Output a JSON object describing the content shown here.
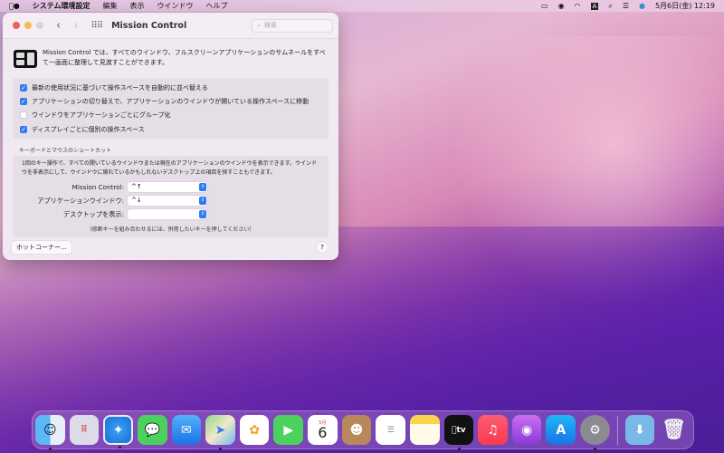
{
  "menubar": {
    "app": "システム環境設定",
    "items": [
      "編集",
      "表示",
      "ウインドウ",
      "ヘルプ"
    ],
    "clock": "5月6日(金)  12:19",
    "input_indicator": "A"
  },
  "window": {
    "title": "Mission Control",
    "search_placeholder": "検索",
    "intro": "Mission Control では、すべてのウインドウ、フルスクリーンアプリケーションのサムネールをすべて一画面に整理して見渡すことができます。",
    "options": [
      {
        "label": "最新の使用状況に基づいて操作スペースを自動的に並べ替える",
        "checked": true
      },
      {
        "label": "アプリケーションの切り替えで、アプリケーションのウインドウが開いている操作スペースに移動",
        "checked": true
      },
      {
        "label": "ウインドウをアプリケーションごとにグループ化",
        "checked": false
      },
      {
        "label": "ディスプレイごとに個別の操作スペース",
        "checked": true
      }
    ],
    "shortcuts_title": "キーボードとマウスのショートカット",
    "shortcuts_desc": "1回のキー操作で、すべての開いているウインドウまたは現在のアプリケーションのウインドウを表示できます。ウインドウを非表示にして、ウインドウに隠れているかもしれないデスクトップ上の項目を探すこともできます。",
    "shortcuts": [
      {
        "label": "Mission Control:",
        "value": "^↑"
      },
      {
        "label": "アプリケーションウインドウ:",
        "value": "^↓"
      },
      {
        "label": "デスクトップを表示:",
        "value": ""
      }
    ],
    "note": "（修飾キーを組み合わせるには、併用したいキーを押してください）",
    "hot_corners": "ホットコーナー...",
    "help": "?"
  },
  "dock": {
    "apps": [
      "Finder",
      "Launchpad",
      "Safari",
      "メッセージ",
      "メール",
      "マップ",
      "写真",
      "FaceTime",
      "カレンダー",
      "連絡先",
      "リマインダー",
      "メモ",
      "TV",
      "ミュージック",
      "Podcast",
      "App Store",
      "システム環境設定"
    ],
    "calendar_month": "5月",
    "calendar_day": "6",
    "tv_label": "tv",
    "others": [
      "ダウンロード",
      "ゴミ箱"
    ]
  }
}
